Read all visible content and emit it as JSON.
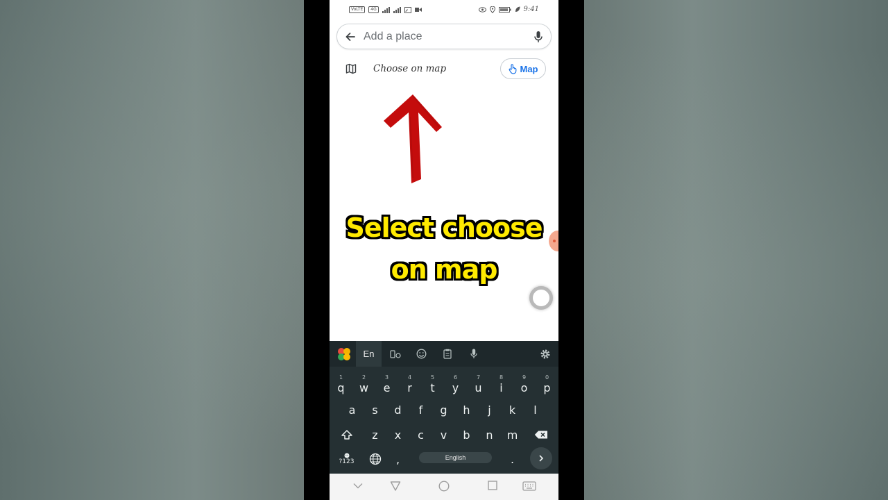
{
  "status_bar": {
    "left_chips": [
      "VoLTE",
      "4G"
    ],
    "time": "9:41"
  },
  "search": {
    "placeholder": "Add a place"
  },
  "choose_row": {
    "label": "Choose on map",
    "map_button_label": "Map"
  },
  "overlay_caption": {
    "line1": "Select choose",
    "line2": "on map",
    "color": "#ffea00",
    "outline_color": "#000000"
  },
  "arrow": {
    "color": "#c40c0c",
    "icon": "up-arrow-icon"
  },
  "keyboard": {
    "language_tab": "En",
    "toolbar_icons": [
      "app-grid-icon",
      "keyboard-layout-icon",
      "emoji-icon",
      "clipboard-icon",
      "mic-icon",
      "settings-icon"
    ],
    "row1": [
      {
        "key": "q",
        "num": "1"
      },
      {
        "key": "w",
        "num": "2"
      },
      {
        "key": "e",
        "num": "3"
      },
      {
        "key": "r",
        "num": "4"
      },
      {
        "key": "t",
        "num": "5"
      },
      {
        "key": "y",
        "num": "6"
      },
      {
        "key": "u",
        "num": "7"
      },
      {
        "key": "i",
        "num": "8"
      },
      {
        "key": "o",
        "num": "9"
      },
      {
        "key": "p",
        "num": "0"
      }
    ],
    "row2": [
      "a",
      "s",
      "d",
      "f",
      "g",
      "h",
      "j",
      "k",
      "l"
    ],
    "row3": [
      "z",
      "x",
      "c",
      "v",
      "b",
      "n",
      "m"
    ],
    "symbols_key": "?123",
    "comma_key": ",",
    "period_key": ".",
    "space_label": "English",
    "background": "#253033"
  },
  "nav_bar": {
    "icons": [
      "hide-keyboard-icon",
      "back-icon",
      "home-icon",
      "recents-icon",
      "keyboard-switch-icon"
    ]
  },
  "colors": {
    "accent": "#1a73e8",
    "page_bg": "#ffffff"
  }
}
